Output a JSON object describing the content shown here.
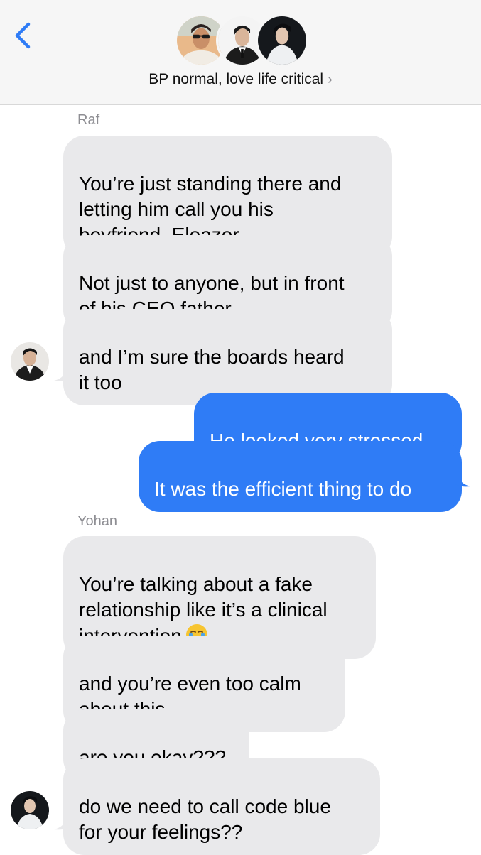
{
  "header": {
    "back_icon": "chevron-left-icon",
    "title": "BP normal, love life critical",
    "title_chevron": "›",
    "accent_color": "#2f7cf6"
  },
  "thread": {
    "raf": {
      "sender_name": "Raf",
      "messages": [
        "You’re just standing there and\nletting him call you his\nboyfriend, Eleazer.",
        "Not just to anyone, but in front\nof his CEO father",
        "and I’m sure the boards heard\nit too"
      ]
    },
    "me": {
      "messages": [
        "He looked very stressed",
        "It was the efficient thing to do"
      ]
    },
    "yohan": {
      "sender_name": "Yohan",
      "messages": [
        "You’re talking about a fake\nrelationship like it’s a clinical\nintervention",
        "and you’re even too calm\nabout this",
        "are you okay???",
        "do we need to call code blue\nfor your feelings??"
      ],
      "emoji": "loudly-crying-face-icon"
    }
  },
  "colors": {
    "incoming_bubble": "#e9e9eb",
    "outgoing_bubble": "#2f7cf6",
    "header_bg": "#f6f6f6",
    "meta_text": "#8e8e93"
  }
}
